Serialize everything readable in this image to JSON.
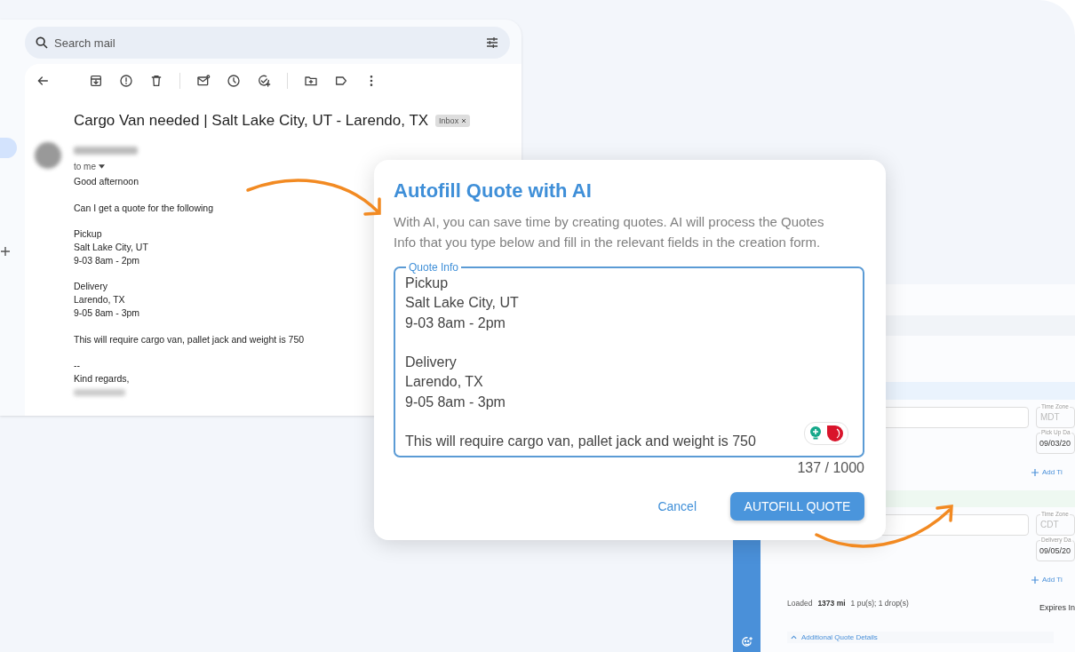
{
  "email_window": {
    "search": {
      "placeholder": "Search mail"
    },
    "subject": "Cargo Van needed | Salt Lake City, UT - Larendo, TX",
    "label_chip": "Inbox",
    "recipient": "to me",
    "body": [
      [
        "Good afternoon"
      ],
      [
        "Can I get a quote for the following"
      ],
      [
        "Pickup",
        "Salt Lake City, UT",
        "9-03 8am - 2pm"
      ],
      [
        "Delivery",
        "Larendo, TX",
        "9-05 8am - 3pm"
      ],
      [
        "This will require cargo van, pallet jack and weight is 750"
      ],
      [
        "--",
        "Kind regards,"
      ]
    ]
  },
  "dialog": {
    "title": "Autofill Quote with AI",
    "description": "With AI, you can save time by creating quotes. AI will process the Quotes Info that you type below and fill in the relevant fields in the creation form.",
    "field": {
      "label": "Quote Info",
      "value": "Pickup\nSalt Lake City, UT\n9-03 8am - 2pm\n\nDelivery\nLarendo, TX\n9-05 8am - 3pm\n\nThis will require cargo van, pallet jack and weight is 750"
    },
    "counter": "137 / 1000",
    "buttons": [
      {
        "label": "Cancel",
        "kind": "text"
      },
      {
        "label": "AUTOFILL QUOTE",
        "kind": "contained"
      }
    ]
  },
  "quote_form": {
    "stops": [
      {
        "time_zone": {
          "label": "Time Zone",
          "placeholder": "MDT"
        },
        "date": {
          "label": "Pick Up Da",
          "value": "09/03/20"
        },
        "add_link": "Add Ti",
        "color": "#eaf3fd"
      },
      {
        "time_zone": {
          "label": "Time Zone",
          "placeholder": "CDT"
        },
        "date": {
          "label": "Delivery Da",
          "value": "09/05/20"
        },
        "add_link": "Add Ti",
        "color": "#eef8f1"
      }
    ],
    "summary": {
      "label": "Loaded",
      "distance": "1373 mi",
      "stops": "1 pu(s); 1 drop(s)"
    },
    "expires_label": "Expires In",
    "details_toggle": "Additional Quote Details"
  }
}
